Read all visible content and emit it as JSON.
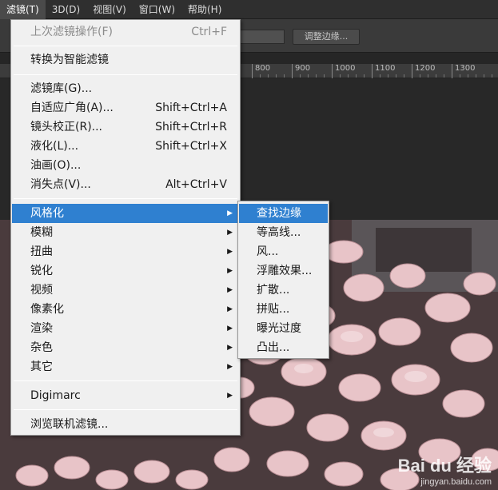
{
  "menubar": {
    "items": [
      {
        "label": "滤镜(T)",
        "active": true
      },
      {
        "label": "3D(D)",
        "active": false
      },
      {
        "label": "视图(V)",
        "active": false
      },
      {
        "label": "窗口(W)",
        "active": false
      },
      {
        "label": "帮助(H)",
        "active": false
      }
    ]
  },
  "options": {
    "refine_edge_label": "调整边缘..."
  },
  "ruler": {
    "ticks": [
      "800",
      "900",
      "1000",
      "1100",
      "1200",
      "1300"
    ]
  },
  "filter_menu": {
    "last_filter": {
      "label": "上次滤镜操作(F)",
      "shortcut": "Ctrl+F"
    },
    "convert_smart": "转换为智能滤镜",
    "gallery": "滤镜库(G)...",
    "adaptive_wide": {
      "label": "自适应广角(A)...",
      "shortcut": "Shift+Ctrl+A"
    },
    "lens_correction": {
      "label": "镜头校正(R)...",
      "shortcut": "Shift+Ctrl+R"
    },
    "liquify": {
      "label": "液化(L)...",
      "shortcut": "Shift+Ctrl+X"
    },
    "oil_paint": "油画(O)...",
    "vanishing_point": {
      "label": "消失点(V)...",
      "shortcut": "Alt+Ctrl+V"
    },
    "groups": [
      "风格化",
      "模糊",
      "扭曲",
      "锐化",
      "视频",
      "像素化",
      "渲染",
      "杂色",
      "其它"
    ],
    "digimarc": "Digimarc",
    "browse_online": "浏览联机滤镜..."
  },
  "stylize_submenu": {
    "items": [
      "查找边缘",
      "等高线...",
      "风...",
      "浮雕效果...",
      "扩散...",
      "拼贴...",
      "曝光过度",
      "凸出..."
    ]
  },
  "watermark": {
    "main": "Bai du 经验",
    "sub": "jingyan.baidu.com"
  },
  "colors": {
    "highlight": "#2f80d0",
    "menu_bg": "#f0f0f0",
    "app_bg": "#2b2b2b"
  }
}
